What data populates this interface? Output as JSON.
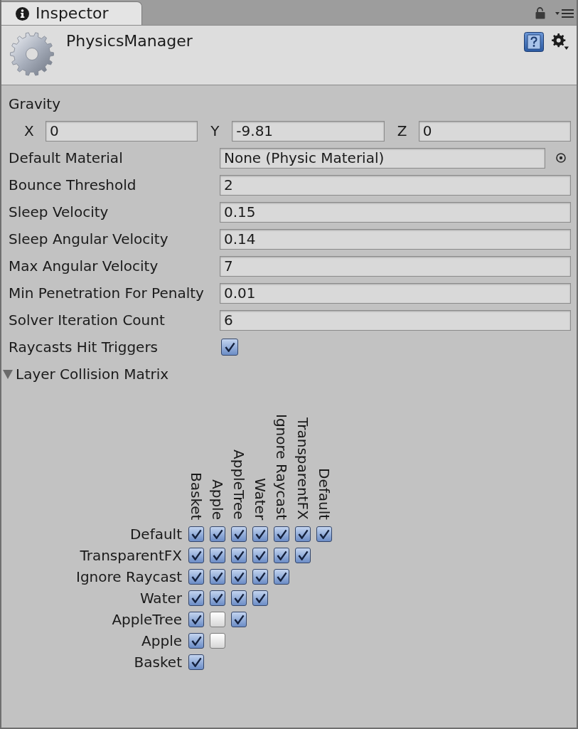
{
  "inspector_tab": {
    "title": "Inspector",
    "selected": true
  },
  "header": {
    "title": "PhysicsManager"
  },
  "gravity": {
    "label": "Gravity",
    "axes": [
      {
        "label": "X",
        "value": "0"
      },
      {
        "label": "Y",
        "value": "-9.81"
      },
      {
        "label": "Z",
        "value": "0"
      }
    ]
  },
  "properties": [
    {
      "kind": "object",
      "label": "Default Material",
      "value": "None (Physic Material)"
    },
    {
      "kind": "number",
      "label": "Bounce Threshold",
      "value": "2"
    },
    {
      "kind": "number",
      "label": "Sleep Velocity",
      "value": "0.15"
    },
    {
      "kind": "number",
      "label": "Sleep Angular Velocity",
      "value": "0.14"
    },
    {
      "kind": "number",
      "label": "Max Angular Velocity",
      "value": "7"
    },
    {
      "kind": "number",
      "label": "Min Penetration For Penalty",
      "value": "0.01"
    },
    {
      "kind": "number",
      "label": "Solver Iteration Count",
      "value": "6"
    },
    {
      "kind": "checkbox",
      "label": "Raycasts Hit Triggers",
      "checked": true
    }
  ],
  "layer_collision_matrix": {
    "label": "Layer Collision Matrix",
    "expanded": true,
    "columns": [
      "Basket",
      "Apple",
      "AppleTree",
      "Water",
      "Ignore Raycast",
      "TransparentFX",
      "Default"
    ],
    "rows": [
      {
        "label": "Default",
        "cells": [
          {
            "checked": true
          },
          {
            "checked": true
          },
          {
            "checked": true
          },
          {
            "checked": true
          },
          {
            "checked": true
          },
          {
            "checked": true
          },
          {
            "checked": true
          }
        ]
      },
      {
        "label": "TransparentFX",
        "cells": [
          {
            "checked": true
          },
          {
            "checked": true
          },
          {
            "checked": true
          },
          {
            "checked": true
          },
          {
            "checked": true
          },
          {
            "checked": true
          }
        ]
      },
      {
        "label": "Ignore Raycast",
        "cells": [
          {
            "checked": true
          },
          {
            "checked": true
          },
          {
            "checked": true
          },
          {
            "checked": true
          },
          {
            "checked": true
          }
        ]
      },
      {
        "label": "Water",
        "cells": [
          {
            "checked": true
          },
          {
            "checked": true
          },
          {
            "checked": true
          },
          {
            "checked": true
          }
        ]
      },
      {
        "label": "AppleTree",
        "cells": [
          {
            "checked": true
          },
          {
            "checked": false
          },
          {
            "checked": true
          }
        ]
      },
      {
        "label": "Apple",
        "cells": [
          {
            "checked": true
          },
          {
            "checked": false
          }
        ]
      },
      {
        "label": "Basket",
        "cells": [
          {
            "checked": true
          }
        ]
      }
    ]
  }
}
